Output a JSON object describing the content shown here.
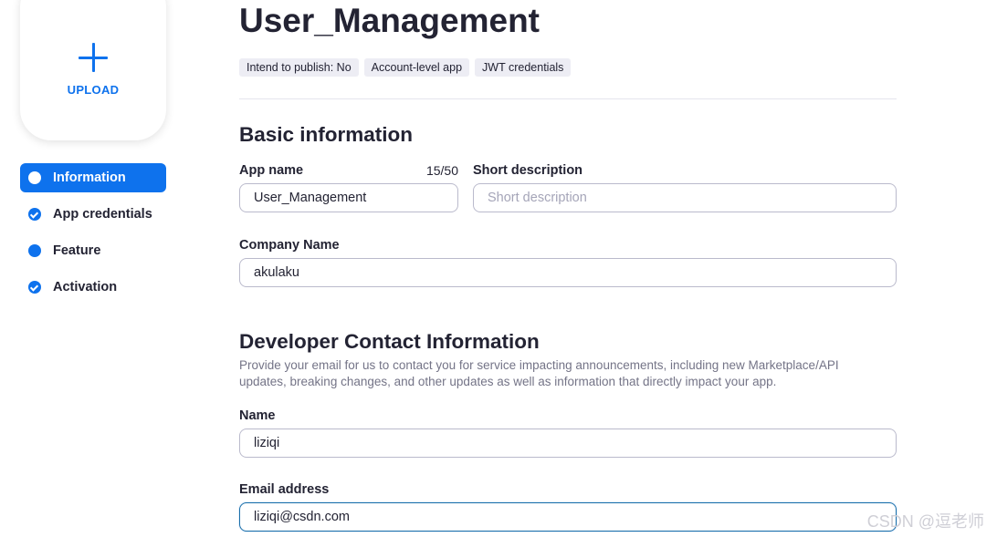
{
  "upload": {
    "label": "UPLOAD",
    "icon": "plus-icon"
  },
  "nav": {
    "items": [
      {
        "label": "Information",
        "state": "active"
      },
      {
        "label": "App credentials",
        "state": "completed"
      },
      {
        "label": "Feature",
        "state": "current"
      },
      {
        "label": "Activation",
        "state": "completed"
      }
    ]
  },
  "header": {
    "title": "User_Management",
    "tags": [
      "Intend to publish: No",
      "Account-level app",
      "JWT credentials"
    ]
  },
  "basic_info": {
    "heading": "Basic information",
    "app_name": {
      "label": "App name",
      "counter": "15/50",
      "value": "User_Management"
    },
    "short_description": {
      "label": "Short description",
      "value": "",
      "placeholder": "Short description"
    },
    "company_name": {
      "label": "Company Name",
      "value": "akulaku"
    }
  },
  "developer_contact": {
    "heading": "Developer Contact Information",
    "description": "Provide your email for us to contact you for service impacting announcements, including new Marketplace/API updates, breaking changes, and other updates as well as information that directly impact your app.",
    "name": {
      "label": "Name",
      "value": "liziqi"
    },
    "email": {
      "label": "Email address",
      "value": "liziqi@csdn.com"
    }
  },
  "watermark": "CSDN @逗老师",
  "colors": {
    "accent": "#0e72ed",
    "text": "#232333",
    "muted": "#747487",
    "tag_bg": "#ededf4",
    "border": "#babacc"
  }
}
